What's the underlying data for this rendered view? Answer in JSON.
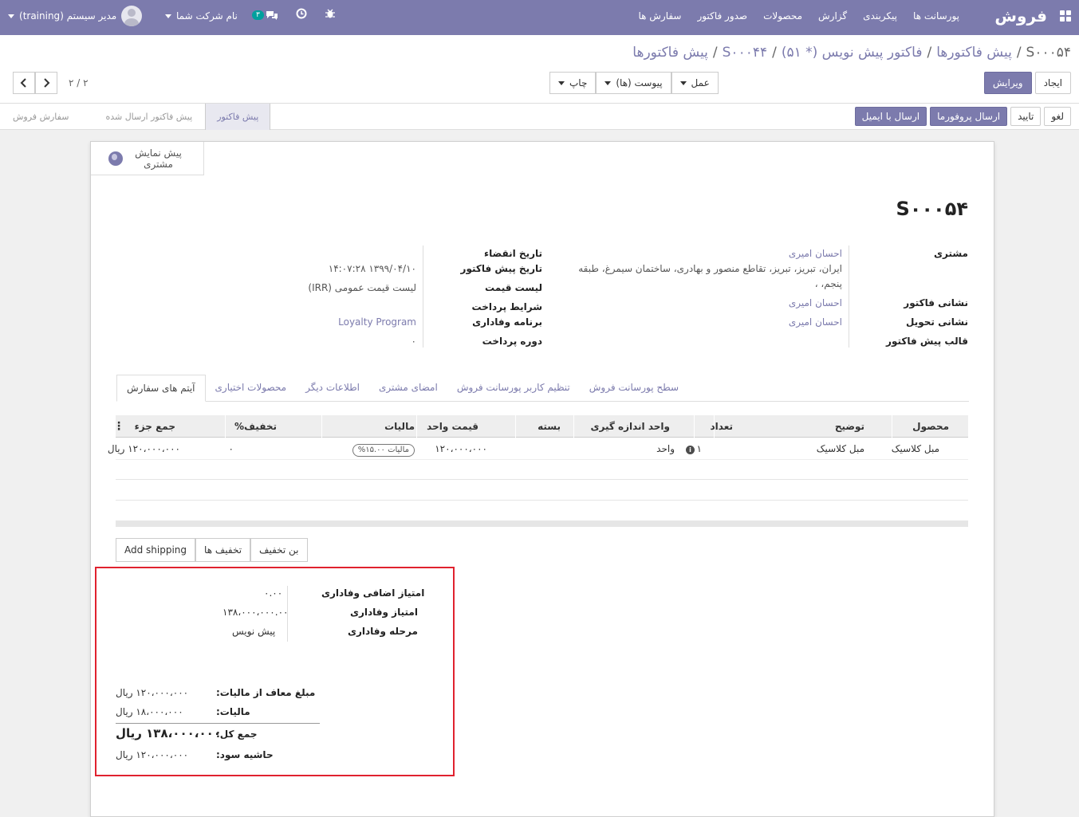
{
  "navbar": {
    "brand": "فروش",
    "menu": [
      "سفارش ها",
      "صدور فاکتور",
      "محصولات",
      "گزارش",
      "پیکربندی",
      "پورسانت ها"
    ],
    "message_count": "۳",
    "company": "نام شرکت شما",
    "user": "مدیر سیستم (training)"
  },
  "breadcrumb": {
    "item1": "پیش فاکتورها",
    "item2": "S۰۰۰۴۴",
    "item3": "فاکتور پیش نویس (* ۵۱)",
    "item4": "پیش فاکتورها",
    "current": "S۰۰۰۵۴",
    "sep": "/"
  },
  "buttons": {
    "edit": "ویرایش",
    "create": "ایجاد",
    "print": "چاپ",
    "attachments": "پیوست (ها)",
    "action": "عمل",
    "pager": "۲ / ۲"
  },
  "statusbar": {
    "send_email": "ارسال با ایمیل",
    "send_proforma": "ارسال پروفورما",
    "confirm": "تایید",
    "cancel": "لغو",
    "stages": [
      "پیش فاکتور",
      "پیش فاکتور ارسال شده",
      "سفارش فروش"
    ],
    "active_stage": "پیش فاکتور"
  },
  "sheet": {
    "customer_preview": "پیش نمایش مشتری",
    "title": "S۰۰۰۵۴",
    "customer_label": "مشتری",
    "customer_name": "احسان امیری",
    "customer_address_1": "ایران، تبریز، تبریز، تقاطع منصور و بهادری، ساختمان سیمرغ، طبقه",
    "customer_address_2": "پنجم، ،",
    "invoice_address_label": "نشانی فاکتور",
    "invoice_address": "احسان امیری",
    "delivery_address_label": "نشانی تحویل",
    "delivery_address": "احسان امیری",
    "quote_template_label": "قالب پیش فاکتور",
    "expiration_label": "تاریخ انقضاء",
    "quotation_date_label": "تاریخ پیش فاکتور",
    "quotation_date": "۱۳۹۹/۰۴/۱۰ ۱۴:۰۷:۲۸",
    "pricelist_label": "لیست قیمت",
    "pricelist": "لیست قیمت عمومی (IRR)",
    "payment_terms_label": "شرایط پرداخت",
    "loyalty_label": "برنامه وفاداری",
    "loyalty": "Loyalty Program",
    "payment_period_label": "دوره پرداخت",
    "payment_period": "۰"
  },
  "tabs": [
    "آیتم های سفارش",
    "محصولات اختیاری",
    "اطلاعات دیگر",
    "امضای مشتری",
    "تنظیم کاربر پورسانت فروش",
    "سطح پورسانت فروش"
  ],
  "order_table": {
    "headers": {
      "product": "محصول",
      "description": "توضیح",
      "qty": "تعداد",
      "uom": "واحد اندازه گیری",
      "package": "بسته",
      "unit_price": "قیمت واحد",
      "taxes": "مالیات",
      "discount": "تخفیف%",
      "subtotal": "جمع جزء"
    },
    "rows": [
      {
        "product": "مبل کلاسیک",
        "description": "مبل کلاسیک",
        "qty": "۱",
        "uom": "واحد",
        "package": "",
        "unit_price": "۱۲۰،۰۰۰،۰۰۰",
        "taxes": "مالیات ۱۵.۰۰%",
        "discount": "۰",
        "subtotal": "۱۲۰،۰۰۰،۰۰۰ ریال"
      }
    ]
  },
  "discount_buttons": {
    "coupon": "بن تخفیف",
    "promotions": "تخفیف ها",
    "shipping": "Add shipping"
  },
  "loyalty_summary": {
    "extra_points_label": "امتیاز اضافی وفاداری",
    "extra_points": "۰.۰۰",
    "points_label": "امتیاز وفاداری",
    "points": "۱۳۸،۰۰۰،۰۰۰.۰۰",
    "stage_label": "مرحله وفاداری",
    "stage": "پیش نویس"
  },
  "totals": {
    "untaxed_label": "مبلغ معاف از مالیات:",
    "untaxed": "۱۲۰،۰۰۰،۰۰۰ ریال",
    "tax_label": "مالیات:",
    "tax": "۱۸،۰۰۰،۰۰۰ ریال",
    "total_label": "جمع کل:",
    "total": "۱۳۸،۰۰۰،۰۰۰ ریال",
    "margin_label": "حاشیه سود:",
    "margin": "۱۲۰،۰۰۰،۰۰۰ ریال"
  },
  "colors": {
    "brand": "#7c7bad",
    "highlight": "#e0222f",
    "badge": "#00a09d"
  }
}
